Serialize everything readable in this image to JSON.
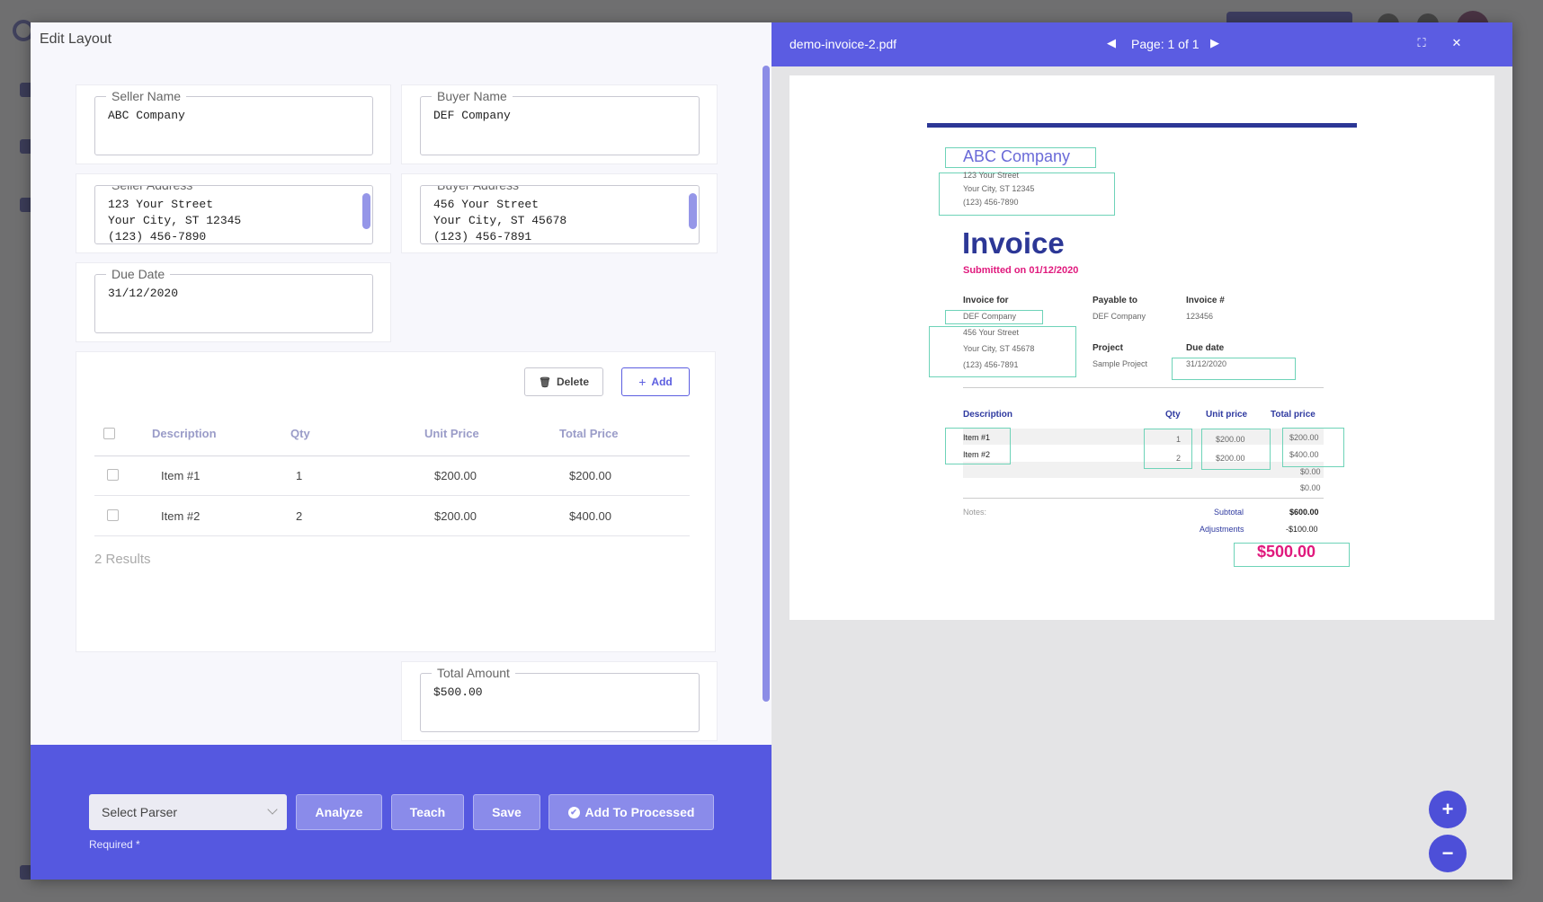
{
  "modal": {
    "title": "Edit Layout"
  },
  "fields": {
    "seller_name": {
      "label": "Seller Name",
      "value": "ABC Company"
    },
    "buyer_name": {
      "label": "Buyer Name",
      "value": "DEF Company"
    },
    "seller_address": {
      "label": "Seller Address",
      "value": "123 Your Street\nYour City, ST 12345\n(123) 456-7890"
    },
    "buyer_address": {
      "label": "Buyer Address",
      "value": "456 Your Street\nYour City, ST 45678\n(123) 456-7891"
    },
    "due_date": {
      "label": "Due Date",
      "value": "31/12/2020"
    },
    "total_amount": {
      "label": "Total Amount",
      "value": "$500.00"
    }
  },
  "items_table": {
    "delete_label": "Delete",
    "add_label": "Add",
    "columns": [
      "Description",
      "Qty",
      "Unit Price",
      "Total Price"
    ],
    "rows": [
      {
        "description": "Item #1",
        "qty": "1",
        "unit_price": "$200.00",
        "total_price": "$200.00"
      },
      {
        "description": "Item #2",
        "qty": "2",
        "unit_price": "$200.00",
        "total_price": "$400.00"
      }
    ],
    "results_text": "2 Results"
  },
  "footer": {
    "select_placeholder": "Select Parser",
    "required_text": "Required *",
    "analyze_label": "Analyze",
    "teach_label": "Teach",
    "save_label": "Save",
    "add_processed_label": "Add To Processed"
  },
  "pdf_viewer": {
    "file_name": "demo-invoice-2.pdf",
    "page_label": "Page: 1 of 1",
    "zoom_in_icon": "+",
    "zoom_out_icon": "−",
    "prev_icon": "◀",
    "next_icon": "▶",
    "fullscreen_icon": "⛶",
    "close_icon": "✕"
  },
  "invoice_doc": {
    "seller_name": "ABC Company",
    "seller_address_1": "123 Your Street",
    "seller_address_2": "Your City, ST 12345",
    "seller_phone": "(123) 456-7890",
    "title": "Invoice",
    "submitted": "Submitted on 01/12/2020",
    "invoice_for_label": "Invoice for",
    "payable_to_label": "Payable to",
    "invoice_no_label": "Invoice #",
    "buyer_name": "DEF Company",
    "buyer_address_1": "456 Your Street",
    "buyer_address_2": "Your City, ST 45678",
    "buyer_phone": "(123) 456-7891",
    "payable_to": "DEF Company",
    "invoice_no": "123456",
    "project_label": "Project",
    "project": "Sample Project",
    "due_date_label": "Due date",
    "due_date": "31/12/2020",
    "col_description": "Description",
    "col_qty": "Qty",
    "col_unit": "Unit price",
    "col_total": "Total price",
    "rows": [
      {
        "description": "Item #1",
        "qty": "1",
        "unit": "$200.00",
        "total": "$200.00"
      },
      {
        "description": "Item #2",
        "qty": "2",
        "unit": "$200.00",
        "total": "$400.00"
      }
    ],
    "empty_total_1": "$0.00",
    "empty_total_2": "$0.00",
    "notes_label": "Notes:",
    "subtotal_label": "Subtotal",
    "subtotal": "$600.00",
    "adjustments_label": "Adjustments",
    "adjustments": "-$100.00",
    "grand_total": "$500.00"
  },
  "colors": {
    "accent": "#5558e0",
    "invoice_title": "#2c3796",
    "invoice_pink": "#e0197d",
    "highlight_box": "#6ed3b8"
  }
}
